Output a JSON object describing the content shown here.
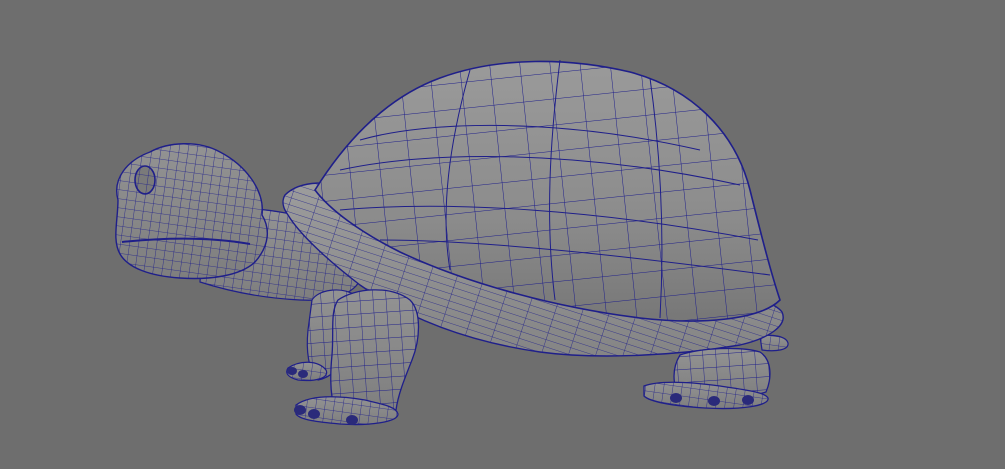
{
  "viewport": {
    "background_color": "#6e6e6e",
    "wireframe_color": "#1f1f8a",
    "surface_color": "#8f8f8f"
  },
  "model": {
    "object": "turtle",
    "display_mode": "wireframe-on-shaded"
  }
}
